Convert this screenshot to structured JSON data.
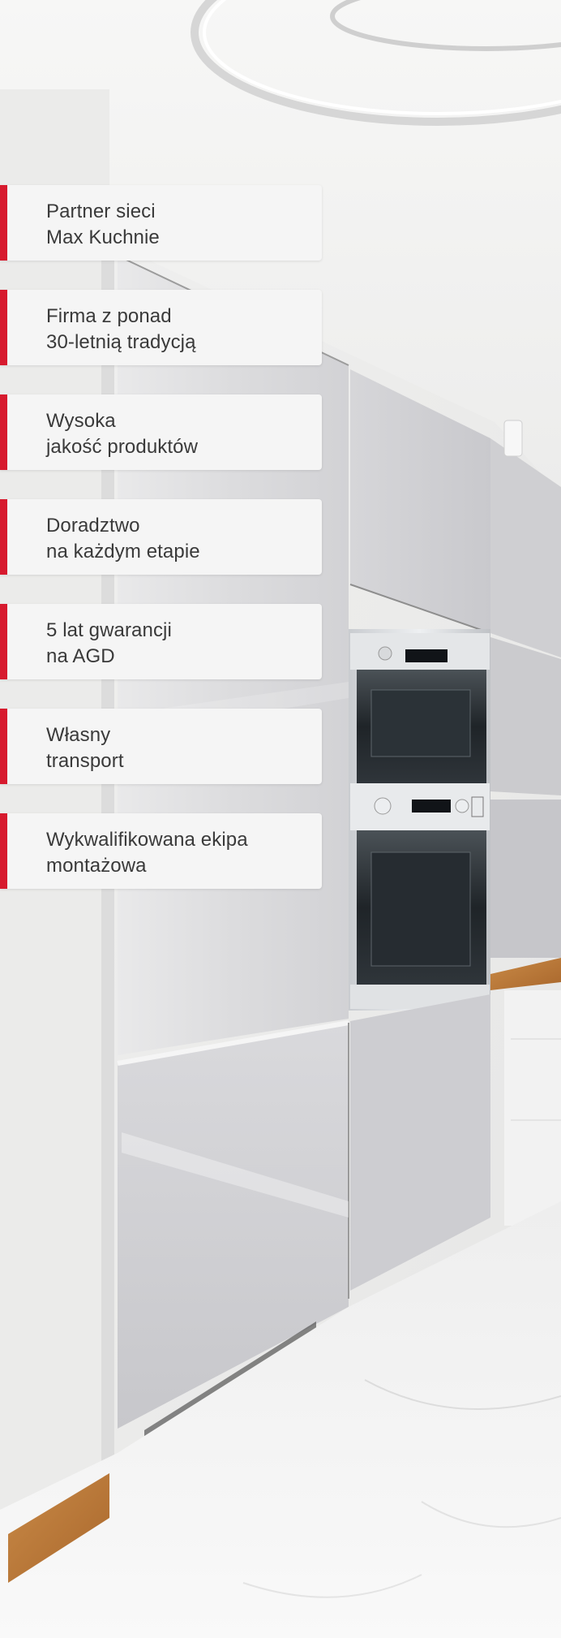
{
  "colors": {
    "accent": "#d71a2e",
    "card_background": "#f5f5f5",
    "text": "#3a3a3a"
  },
  "features": [
    {
      "line1": "Partner sieci",
      "line2": "Max Kuchnie"
    },
    {
      "line1": "Firma z ponad",
      "line2": "30-letnią tradycją"
    },
    {
      "line1": "Wysoka",
      "line2": "jakość produktów"
    },
    {
      "line1": "Doradztwo",
      "line2": "na każdym etapie"
    },
    {
      "line1": "5 lat gwarancji",
      "line2": "na AGD"
    },
    {
      "line1": "Własny",
      "line2": "transport"
    },
    {
      "line1": "Wykwalifikowana ekipa",
      "line2": "montażowa"
    }
  ]
}
